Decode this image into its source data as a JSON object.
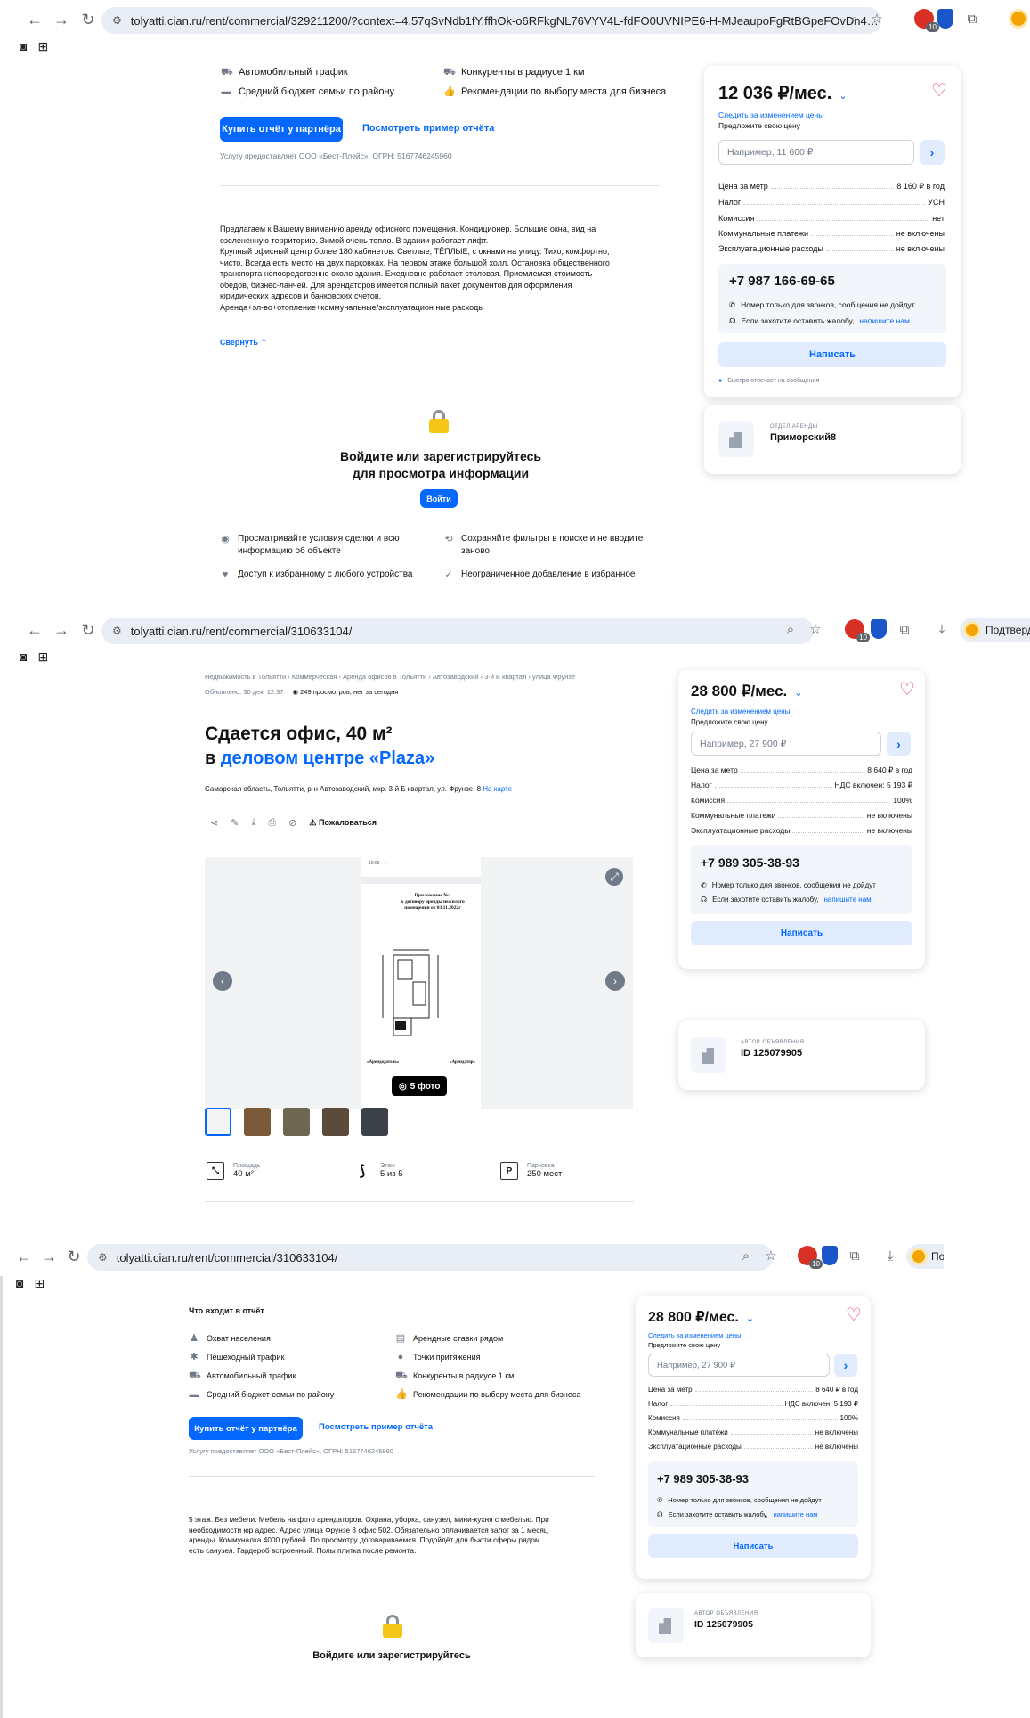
{
  "accent": "#0468ff",
  "shot1": {
    "url": "tolyatti.cian.ru/rent/commercial/329211200/?context=4.57qSvNdb1fY.ffhOk-o6RFkgNL76VYV4L-fdFO0UVNIPE6-H-MJeaupoFgRtBGpeFOvDn4h5uJeg...",
    "ext_badge": "10",
    "report_items": [
      {
        "icon": "car-icon",
        "label": "Автомобильный трафик"
      },
      {
        "icon": "competitors-icon",
        "label": "Конкуренты в радиусе 1 км"
      },
      {
        "icon": "wallet-icon",
        "label": "Средний бюджет семьи по району"
      },
      {
        "icon": "thumb-icon",
        "label": "Рекомендации по выбору места для бизнеса"
      }
    ],
    "buy_report": "Купить отчёт у партнёра",
    "sample_report": "Посмотреть пример отчёта",
    "provider": "Услугу предоставляет ООО «Бест-Плейс», ОГРН: 5167746245960",
    "description": [
      "Предлагаем к Вашему вниманию аренду офисного помещения. Кондиционер. Большие окна, вид на",
      "озелененную территорию. Зимой очень тепло. В здании работает лифт.",
      "Крупный офисный центр более 180 кабинетов. Светлые, ТЁПЛЫЕ, с окнами на улицу. Тихо, комфортно,",
      "чисто. Всегда есть место на двух парковках. На первом этаже большой холл. Остановка общественного",
      "транспорта непосредственно около здания. Ежедневно работает столовая. Приемлемая стоимость",
      "обедов, бизнес-ланчей. Для арендаторов имеется полный пакет документов для оформления",
      "юридических адресов и банковских счетов.",
      "Аренда+эл-во+отопление+коммунальные/эксплуатацион ные расходы"
    ],
    "collapse": "Свернуть",
    "login_title": [
      "Войдите или зарегистрируйтесь",
      "для просмотра информации"
    ],
    "login_btn": "Войти",
    "benefits": [
      {
        "icon": "eye-icon",
        "lines": [
          "Просматривайте условия сделки и всю",
          "информацию об объекте"
        ]
      },
      {
        "icon": "filter-icon",
        "lines": [
          "Сохраняйте фильтры в поиске и не вводите",
          "заново"
        ]
      },
      {
        "icon": "heart-icon",
        "lines": [
          "Доступ к избранному с любого устройства"
        ]
      },
      {
        "icon": "check-icon",
        "lines": [
          "Неограниченное добавление в избранное"
        ]
      }
    ],
    "card": {
      "price": "12 036 ₽/мес.",
      "follow": "Следить за изменением цены",
      "offer_label": "Предложите свою цену",
      "offer_placeholder": "Например, 11 600 ₽",
      "rows": [
        {
          "k": "Цена за метр",
          "v": "8 160 ₽ в год"
        },
        {
          "k": "Налог",
          "v": "УСН"
        },
        {
          "k": "Комиссия",
          "v": "нет"
        },
        {
          "k": "Коммунальные платежи",
          "v": "не включены"
        },
        {
          "k": "Эксплуатационные расходы",
          "v": "не включены"
        }
      ],
      "phone": "+7 987 166-69-65",
      "note1": "Номер только для звонков, сообщения не дойдут",
      "note2_pre": "Если захотите оставить жалобу,",
      "note2_link": "напишите нам",
      "write": "Написать",
      "fast": "Быстро отвечает на сообщения",
      "agent_role": "ОТДЕЛ АРЕНДЫ",
      "agent_name": "Приморский8"
    }
  },
  "shot2": {
    "url": "tolyatti.cian.ru/rent/commercial/310633104/",
    "ext_badge": "10",
    "ext_label": "Подтверди",
    "crumbs": "Недвижимость в Тольятти  ›  Коммерческая  ›  Аренда офисов в Тольятти  ›  Автозаводский  ›  3-й Б квартал  ›  улица Фрунзе",
    "updated": "Обновлено: 30 дек, 12:37",
    "views": "249 просмотров, нет за сегодня",
    "title": "Сдается офис, 40 м²",
    "subtitle_pre": "в",
    "subtitle_link": "деловом центре «Plaza»",
    "address": "Самарская область, Тольятти, р-н Автозаводский, мкр. 3-й Б квартал, ул. Фрунзе, 8",
    "on_map": "На карте",
    "complain": "Пожаловаться",
    "photo_count": "5 фото",
    "doc_title": [
      "Приложение №1",
      "к договору аренды нежилого",
      "помещения от 03.11.2022г"
    ],
    "doc_sign": [
      "«Арендодатель»",
      "«Арендатор»"
    ],
    "specs": [
      {
        "label": "Площадь",
        "value": "40 м²"
      },
      {
        "label": "Этаж",
        "value": "5 из 5"
      },
      {
        "label": "Парковка",
        "value": "250 мест"
      }
    ],
    "card": {
      "price": "28 800 ₽/мес.",
      "follow": "Следить за изменением цены",
      "offer_label": "Предложите свою цену",
      "offer_placeholder": "Например, 27 900 ₽",
      "rows": [
        {
          "k": "Цена за метр",
          "v": "8 640 ₽ в год"
        },
        {
          "k": "Налог",
          "v": "НДС включен: 5 193 ₽"
        },
        {
          "k": "Комиссия",
          "v": "100%"
        },
        {
          "k": "Коммунальные платежи",
          "v": "не включены"
        },
        {
          "k": "Эксплуатационные расходы",
          "v": "не включены"
        }
      ],
      "phone": "+7 989 305-38-93",
      "note1": "Номер только для звонков, сообщения не дойдут",
      "note2_pre": "Если захотите оставить жалобу,",
      "note2_link": "напишите нам",
      "write": "Написать",
      "agent_role": "АВТОР ОБЪЯВЛЕНИЯ",
      "agent_name": "ID 125079905"
    }
  },
  "shot3": {
    "url": "tolyatti.cian.ru/rent/commercial/310633104/",
    "ext_badge": "10",
    "ext_label": "По",
    "report_title": "Что входит в отчёт",
    "report_items": [
      {
        "icon": "people-icon",
        "label": "Охват населения"
      },
      {
        "icon": "rates-icon",
        "label": "Арендные ставки рядом"
      },
      {
        "icon": "walk-icon",
        "label": "Пешеходный трафик"
      },
      {
        "icon": "pin-icon",
        "label": "Точки притяжения"
      },
      {
        "icon": "car-icon",
        "label": "Автомобильный трафик"
      },
      {
        "icon": "competitors-icon",
        "label": "Конкуренты в радиусе 1 км"
      },
      {
        "icon": "wallet-icon",
        "label": "Средний бюджет семьи по району"
      },
      {
        "icon": "thumb-icon",
        "label": "Рекомендации по выбору места для бизнеса"
      }
    ],
    "buy_report": "Купить отчёт у партнёра",
    "sample_report": "Посмотреть пример отчёта",
    "provider": "Услугу предоставляет ООО «Бест-Плейс», ОГРН: 5167746245960",
    "description": [
      "5 этаж. Без мебели. Мебель на фото арендаторов. Охрана, уборка, санузел, мини-кухня с мебелью. При",
      "необходимости юр адрес. Адрес улица Фрунзе 8 офис 502. Обязательно оплачивается залог за 1 месяц",
      "аренды. Коммуналка 4000 рублей. По просмотру договариваемся. Подойдёт для бьюти сферы рядом",
      "есть санузел. Гардероб встроенный. Полы плитка после ремонта."
    ],
    "login_title": "Войдите или зарегистрируйтесь",
    "card": {
      "price": "28 800 ₽/мес.",
      "follow": "Следить за изменением цены",
      "offer_label": "Предложите свою цену",
      "offer_placeholder": "Например, 27 900 ₽",
      "rows": [
        {
          "k": "Цена за метр",
          "v": "8 640 ₽ в год"
        },
        {
          "k": "Налог",
          "v": "НДС включен: 5 193 ₽"
        },
        {
          "k": "Комиссия",
          "v": "100%"
        },
        {
          "k": "Коммунальные платежи",
          "v": "не включены"
        },
        {
          "k": "Эксплуатационные расходы",
          "v": "не включены"
        }
      ],
      "phone": "+7 989 305-38-93",
      "note1": "Номер только для звонков, сообщения не дойдут",
      "note2_pre": "Если захотите оставить жалобу,",
      "note2_link": "напишите нам",
      "write": "Написать",
      "agent_role": "АВТОР ОБЪЯВЛЕНИЯ",
      "agent_name": "ID 125079905"
    }
  }
}
